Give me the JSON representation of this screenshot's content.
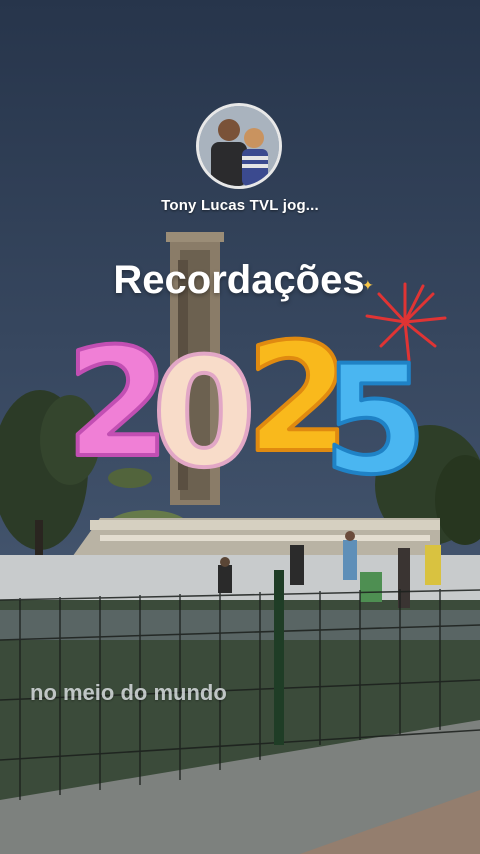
{
  "profile": {
    "name": "Tony Lucas TVL  jog..."
  },
  "story": {
    "title": "Recordações",
    "year": "2025",
    "caption": "no meio do mundo"
  },
  "colors": {
    "sky_top": "#2b3a52",
    "sky_bottom": "#42546e",
    "digit_2_first": "#f07fd6",
    "digit_0": "#f6d7c6",
    "digit_2_second": "#f7b21f",
    "digit_5": "#49b3f0",
    "firework": "#e03030"
  }
}
